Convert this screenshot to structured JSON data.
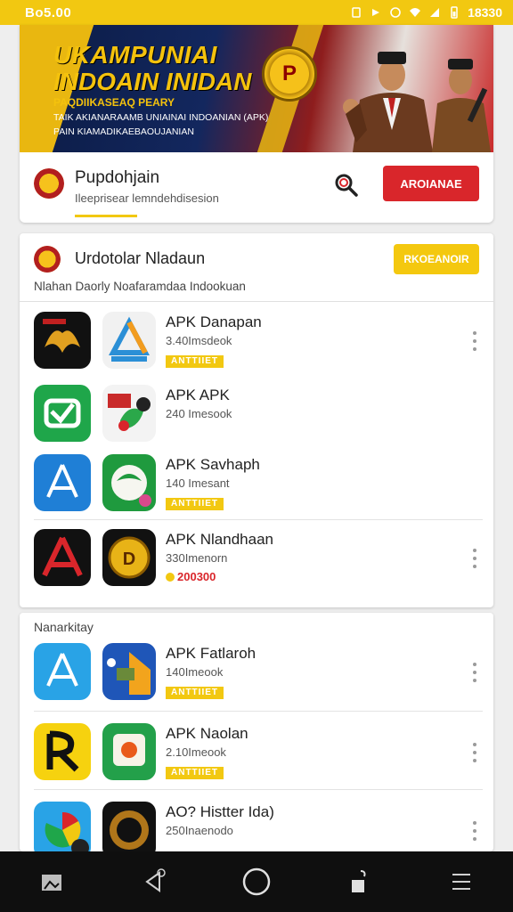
{
  "status_bar": {
    "time": "Bo5.00",
    "clock": "18330"
  },
  "banner": {
    "title_line1": "UKAMPUNIAI",
    "title_line2": "INDOAIN INIDAN",
    "subtitle": "PAQDIIKASEAQ PEARY",
    "line1": "TAIK AKIANARAAMB UNIAINAI INDOANIAN (APK)",
    "line2": "PAIN KIAMADIKAEBAOUJANIAN",
    "emblem_letter": "P"
  },
  "app_header": {
    "name": "Pupdohjain",
    "subtitle": "Ileeprisear lemndehdisesion",
    "action_label": "AROIANAE"
  },
  "section1": {
    "title": "Urdotolar Nladaun",
    "button_label": "RKOEANOIR",
    "subtitle": "Nlahan Daorly Noafaramdaa Indookuan",
    "items": [
      {
        "name": "APK Danapan",
        "size": "3.40Imsdeok",
        "badge": "ANTTIIET"
      },
      {
        "name": "APK APK",
        "size": "240 Imesook"
      },
      {
        "name": "APK Savhaph",
        "size": "140 Imesant",
        "badge": "ANTTIIET"
      },
      {
        "name": "APK Nlandhaan",
        "size": "330Imenorn",
        "price": "200300"
      }
    ]
  },
  "section2": {
    "title": "Nanarkitay",
    "items": [
      {
        "name": "APK Fatlaroh",
        "size": "140Imeook",
        "badge": "ANTTIIET"
      },
      {
        "name": "APK Naolan",
        "size": "2.10Imeook",
        "badge": "ANTTIIET"
      },
      {
        "name": "AO? Histter Ida)",
        "size": "250Inaenodo"
      }
    ]
  },
  "icons": {
    "nav": [
      "gallery-icon",
      "back-icon",
      "home-icon",
      "recents-icon",
      "menu-icon"
    ]
  },
  "colors": {
    "accent": "#f2c811",
    "primary_red": "#d9262b",
    "nav_bg": "#0f0f0f"
  }
}
